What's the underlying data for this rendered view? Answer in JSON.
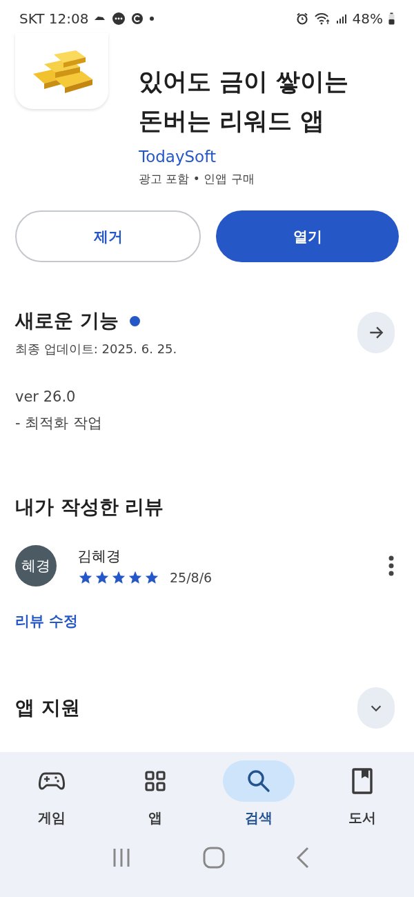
{
  "status_bar": {
    "carrier": "SKT",
    "time": "12:08",
    "battery": "48%"
  },
  "app": {
    "title": "있어도 금이 쌓이는 돈버는 리워드 앱",
    "developer": "TodaySoft",
    "notes": "광고 포함 • 인앱 구매"
  },
  "buttons": [
    {
      "label": "제거",
      "kind": "outline"
    },
    {
      "label": "열기",
      "kind": "filled"
    }
  ],
  "whats_new": {
    "title": "새로운 기능",
    "unread": true,
    "updated": "최종 업데이트: 2025. 6. 25.",
    "lines": [
      "ver 26.0",
      "- 최적화 작업"
    ]
  },
  "my_review": {
    "title": "내가 작성한 리뷰",
    "avatar": "혜경",
    "author": "김혜경",
    "stars": 5,
    "date": "25/8/6",
    "edit_link": "리뷰 수정"
  },
  "app_support": {
    "title": "앱 지원",
    "expanded": false
  },
  "bottom_nav": [
    {
      "label": "게임",
      "kind": "gamepad",
      "selected": false
    },
    {
      "label": "앱",
      "kind": "apps",
      "selected": false
    },
    {
      "label": "검색",
      "kind": "search",
      "selected": true
    },
    {
      "label": "도서",
      "kind": "book",
      "selected": false
    }
  ]
}
